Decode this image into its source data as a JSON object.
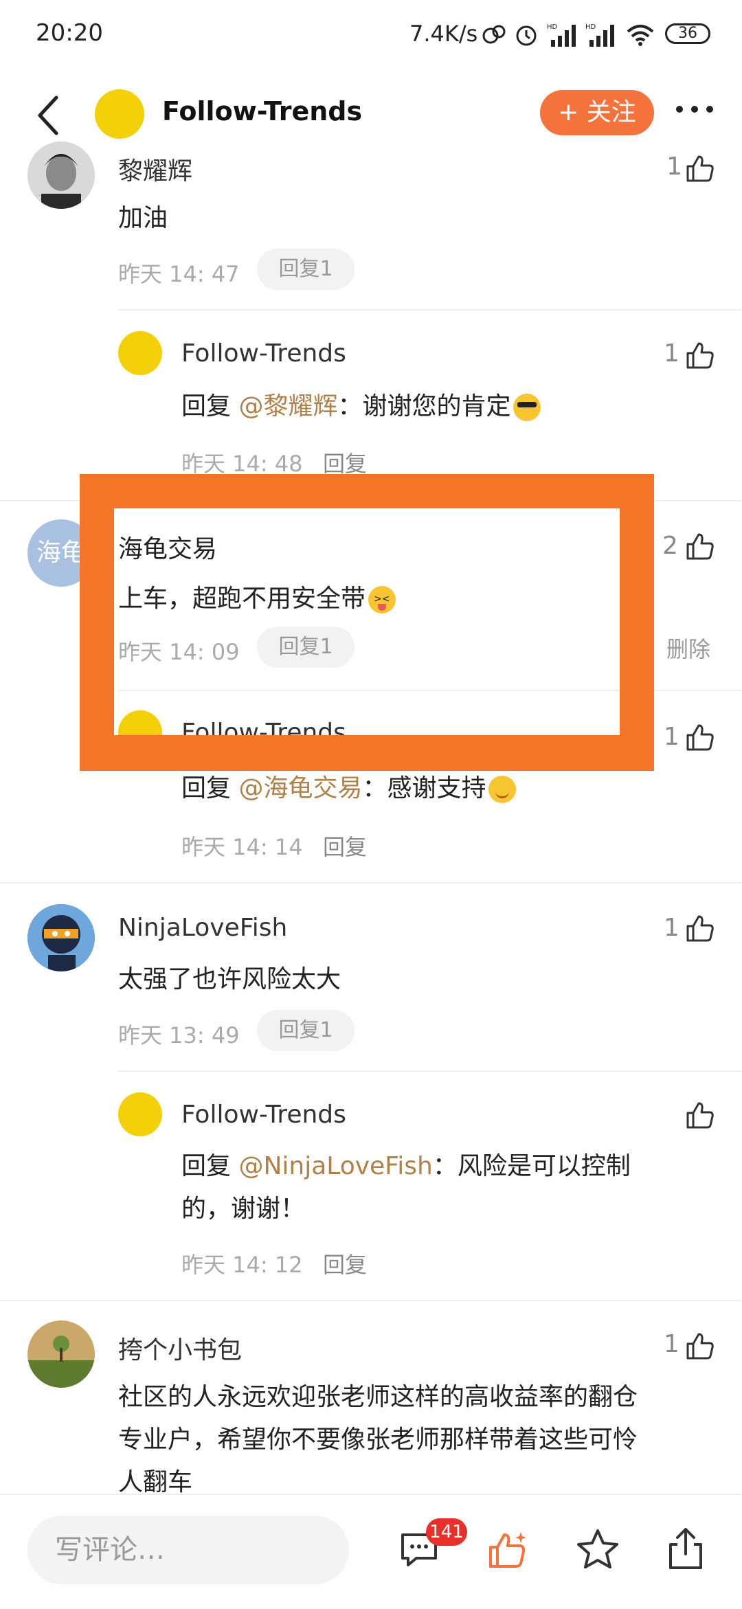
{
  "status_bar": {
    "time": "20:20",
    "speed": "7.4K/s",
    "battery": "36"
  },
  "header": {
    "title": "Follow-Trends",
    "follow_label": "+ 关注"
  },
  "comments": [
    {
      "name": "黎耀辉",
      "text": "加油",
      "time": "昨天 14: 47",
      "reply_btn": "回复1",
      "likes": "1",
      "reply": {
        "name": "Follow-Trends",
        "prefix": "回复 ",
        "mention": "@黎耀辉",
        "text": "：谢谢您的肯定",
        "time": "昨天 14: 48",
        "reply_label": "回复",
        "likes": "1"
      }
    },
    {
      "name": "海龟交易",
      "avatar_text": "海龟",
      "text": "上车，超跑不用安全带",
      "time": "昨天 14: 09",
      "reply_btn": "回复1",
      "likes": "2",
      "delete_label": "删除",
      "reply": {
        "name": "Follow-Trends",
        "prefix": "回复 ",
        "mention": "@海龟交易",
        "text": "：感谢支持",
        "time": "昨天 14: 14",
        "reply_label": "回复",
        "likes": "1"
      }
    },
    {
      "name": "NinjaLoveFish",
      "text": "太强了也许风险太大",
      "time": "昨天 13: 49",
      "reply_btn": "回复1",
      "likes": "1",
      "reply": {
        "name": "Follow-Trends",
        "prefix": "回复 ",
        "mention": "@NinjaLoveFish",
        "text_line1": "：风险是可以控制",
        "text_line2": "的，谢谢！",
        "time": "昨天 14: 12",
        "reply_label": "回复"
      }
    },
    {
      "name": "挎个小书包",
      "likes": "1",
      "text_line1": "社区的人永远欢迎张老师这样的高收益率的翻仓",
      "text_line2": "专业户，希望你不要像张老师那样带着这些可怜",
      "text_line3": "人翻车"
    }
  ],
  "bottom_bar": {
    "input_placeholder": "写评论…",
    "comment_count": "141"
  },
  "colors": {
    "accent": "#f4723b",
    "highlight": "#f57628",
    "mention": "#b0804a",
    "avatar_yellow": "#f2cf07"
  }
}
